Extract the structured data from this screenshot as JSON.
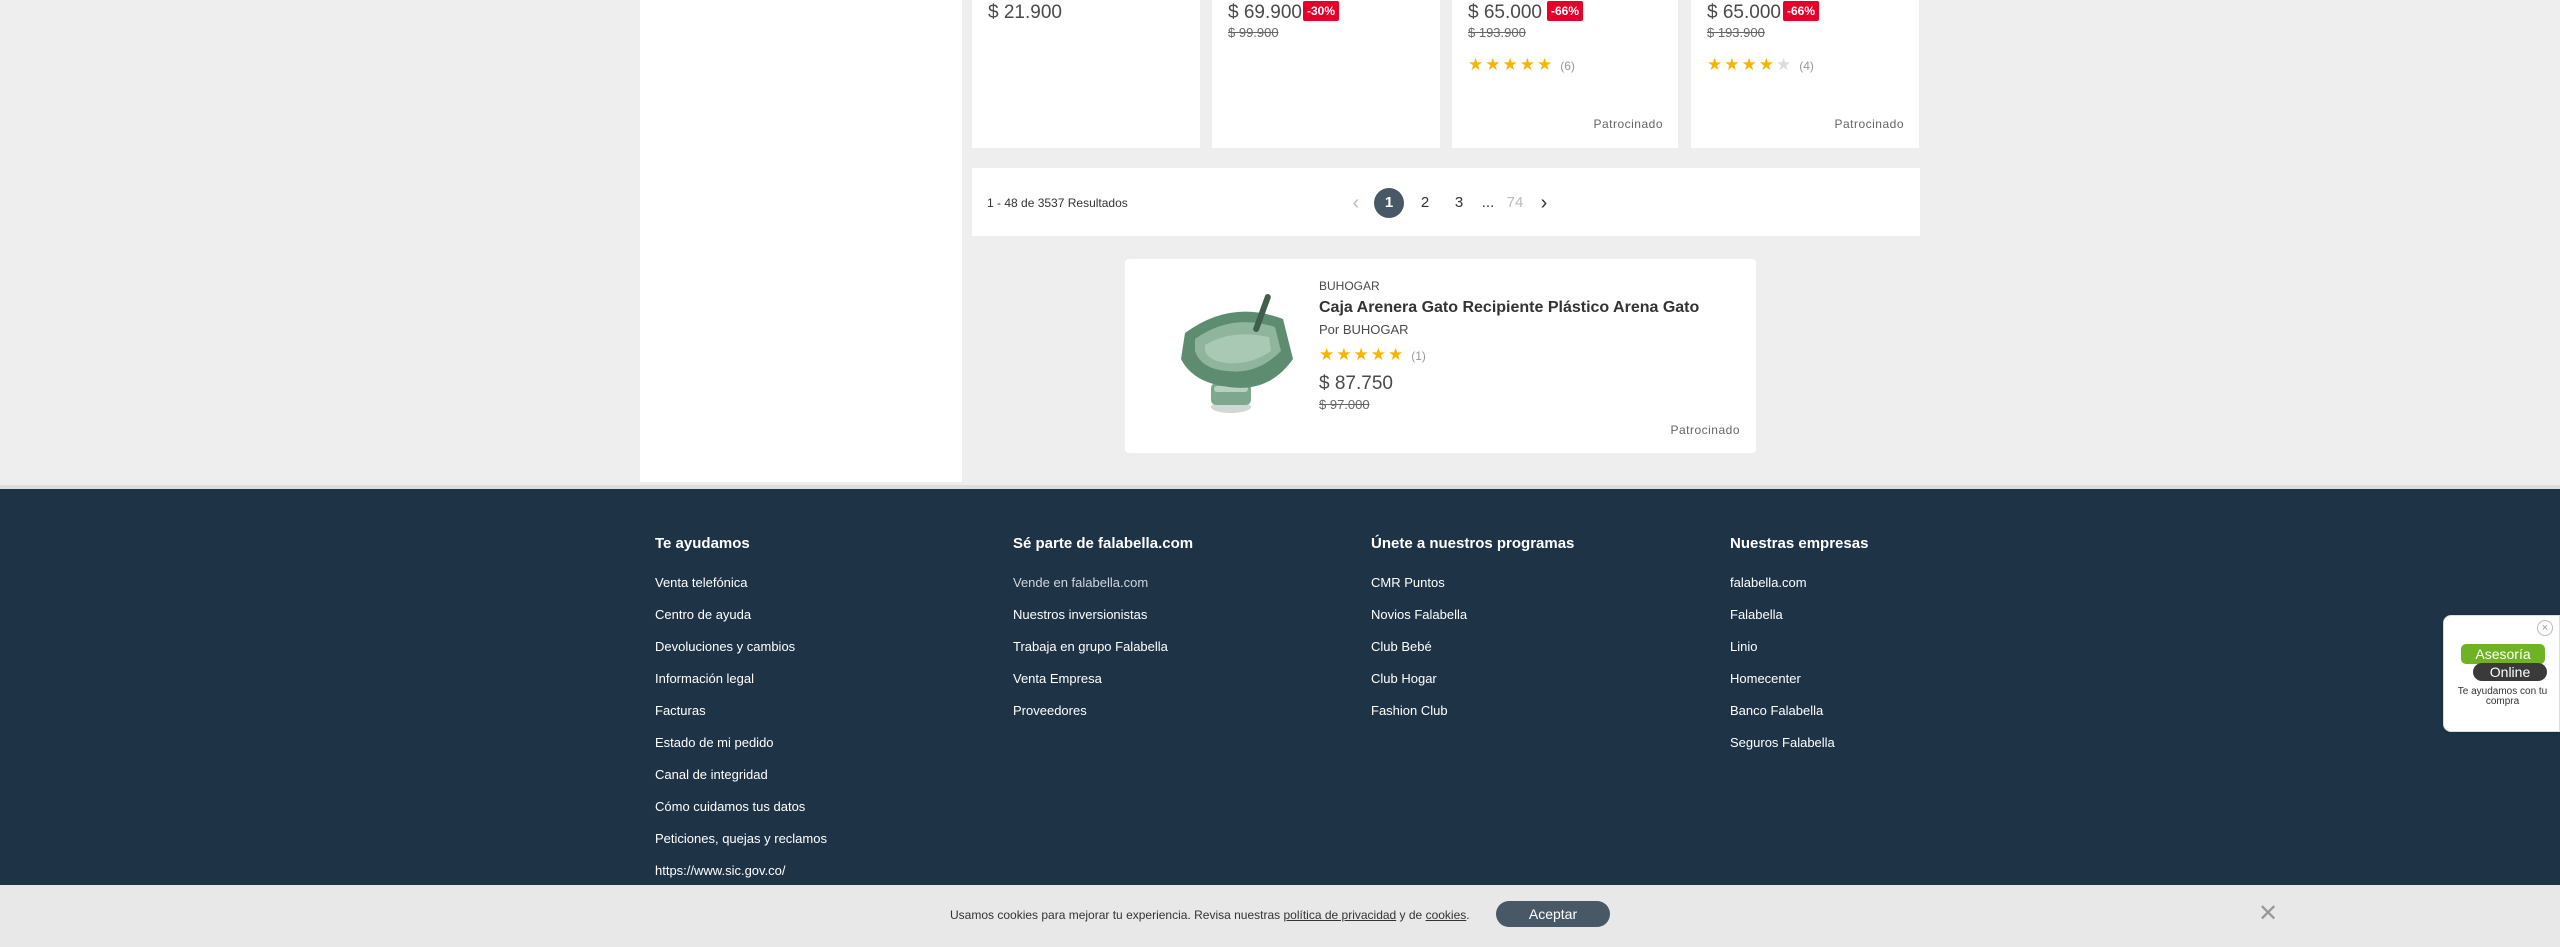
{
  "product_cards": [
    {
      "price": "$ 21.900",
      "badge": "",
      "old_price": "",
      "rating": 0,
      "review_count": "",
      "sponsored": ""
    },
    {
      "price": "$ 69.900",
      "badge": "-30%",
      "old_price": "$ 99.900",
      "rating": 0,
      "review_count": "",
      "sponsored": ""
    },
    {
      "price": "$ 65.000",
      "badge": "-66%",
      "old_price": "$ 193.900",
      "rating": 5,
      "review_count": "(6)",
      "sponsored": "Patrocinado"
    },
    {
      "price": "$ 65.000",
      "badge": "-66%",
      "old_price": "$ 193.900",
      "rating": 4,
      "review_count": "(4)",
      "sponsored": "Patrocinado"
    }
  ],
  "pagination": {
    "results_text": "1 - 48 de 3537 Resultados",
    "current_page": "1",
    "pages": [
      "2",
      "3"
    ],
    "ellipsis": "...",
    "last_page": "74",
    "prev_arrow": "‹",
    "next_arrow": "›"
  },
  "featured_product": {
    "brand": "BUHOGAR",
    "title": "Caja Arenera Gato Recipiente Plástico Arena Gato",
    "seller": "Por BUHOGAR",
    "rating": 5,
    "review_count": "(1)",
    "price": "$ 87.750",
    "old_price": "$ 97.000",
    "sponsored": "Patrocinado"
  },
  "footer": {
    "columns": [
      {
        "heading": "Te ayudamos",
        "links": [
          "Venta telefónica",
          "Centro de ayuda",
          "Devoluciones y cambios",
          "Información legal",
          "Facturas",
          "Estado de mi pedido",
          "Canal de integridad",
          "Cómo cuidamos tus datos",
          "Peticiones, quejas y reclamos",
          "https://www.sic.gov.co/"
        ]
      },
      {
        "heading": "Sé parte de falabella.com",
        "links": [
          "Vende en falabella.com",
          "Nuestros inversionistas",
          "Trabaja en grupo Falabella",
          "Venta Empresa",
          "Proveedores"
        ]
      },
      {
        "heading": "Únete a nuestros programas",
        "links": [
          "CMR Puntos",
          "Novios Falabella",
          "Club Bebé",
          "Club Hogar",
          "Fashion Club"
        ]
      },
      {
        "heading": "Nuestras empresas",
        "links": [
          "falabella.com",
          "Falabella",
          "Linio",
          "Homecenter",
          "Banco Falabella",
          "Seguros Falabella"
        ]
      }
    ]
  },
  "cookie_bar": {
    "text_before": "Usamos cookies para mejorar tu experiencia. Revisa nuestras ",
    "privacy_link": "política de privacidad",
    "text_middle": " y de ",
    "cookies_link": "cookies",
    "text_after": ".",
    "accept_label": "Aceptar",
    "close_symbol": "✕"
  },
  "chat_widget": {
    "logo_line1": "Asesoría",
    "logo_line2": "Online",
    "caption": "Te ayudamos con tu compra",
    "close_symbol": "×"
  },
  "colors": {
    "footer_bg": "#1f3347",
    "discount_badge": "#e4002b",
    "star": "#f7b500",
    "accent_button": "#495867"
  },
  "icons": [
    "chevron-left-icon",
    "chevron-right-icon",
    "star-icon",
    "close-icon"
  ]
}
